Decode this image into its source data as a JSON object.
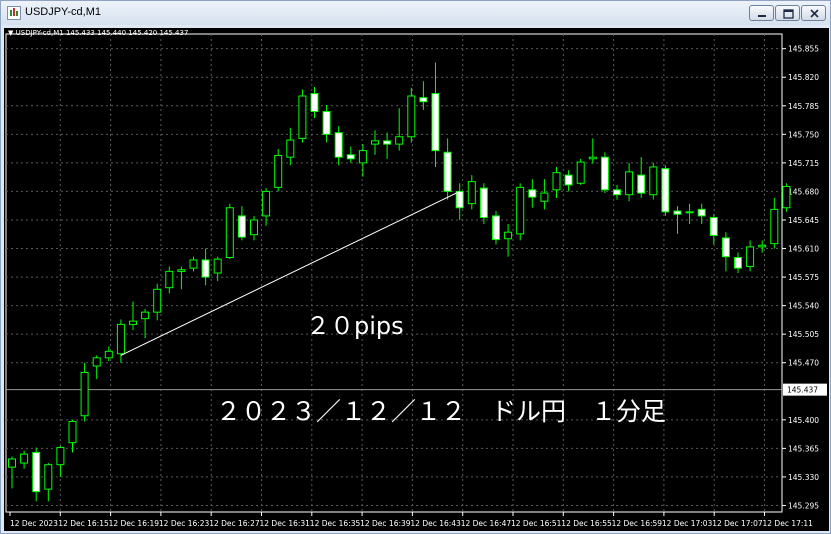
{
  "window": {
    "title": "USDJPY-cd,M1",
    "buttons": [
      {
        "name": "minimize-button",
        "icon": "minimize-icon"
      },
      {
        "name": "restore-button",
        "icon": "restore-icon"
      },
      {
        "name": "close-button",
        "icon": "close-icon"
      }
    ]
  },
  "chart": {
    "header_symbol": "USDJPY-cd,M1",
    "header_ohlc": "145.433 145.440 145.420 145.437",
    "annotation_pips": "２０pips",
    "annotation_title": "２０２３／１２／１２　ドル円　１分足",
    "current_price_label": "145.437",
    "colors": {
      "background": "#000000",
      "bull_body": "#000000",
      "bear_body": "#ffffff",
      "wick": "#00ff00",
      "grid": "#5a5a5a",
      "axis_text": "#ffffff",
      "trendline": "#ffffff"
    }
  },
  "chart_data": {
    "type": "candlestick",
    "symbol": "USDJPY-cd",
    "timeframe": "M1",
    "y_ticks": [
      "145.855",
      "145.820",
      "145.785",
      "145.750",
      "145.715",
      "145.680",
      "145.645",
      "145.610",
      "145.575",
      "145.540",
      "145.505",
      "145.470",
      "145.437",
      "145.400",
      "145.365",
      "145.330",
      "145.295"
    ],
    "x_ticks": [
      "12 Dec 2023",
      "12 Dec 16:15",
      "12 Dec 16:19",
      "12 Dec 16:23",
      "12 Dec 16:27",
      "12 Dec 16:31",
      "12 Dec 16:35",
      "12 Dec 16:39",
      "12 Dec 16:43",
      "12 Dec 16:47",
      "12 Dec 16:51",
      "12 Dec 16:55",
      "12 Dec 16:59",
      "12 Dec 17:03",
      "12 Dec 17:07",
      "12 Dec 17:11"
    ],
    "ylim": [
      145.287,
      145.873
    ],
    "grid": true,
    "current_price": 145.437,
    "candles": [
      {
        "o": 145.342,
        "h": 145.355,
        "l": 145.316,
        "c": 145.352
      },
      {
        "o": 145.347,
        "h": 145.362,
        "l": 145.34,
        "c": 145.358
      },
      {
        "o": 145.36,
        "h": 145.366,
        "l": 145.3,
        "c": 145.312
      },
      {
        "o": 145.315,
        "h": 145.347,
        "l": 145.3,
        "c": 145.345
      },
      {
        "o": 145.345,
        "h": 145.368,
        "l": 145.33,
        "c": 145.366
      },
      {
        "o": 145.372,
        "h": 145.4,
        "l": 145.36,
        "c": 145.398
      },
      {
        "o": 145.405,
        "h": 145.47,
        "l": 145.398,
        "c": 145.458
      },
      {
        "o": 145.466,
        "h": 145.479,
        "l": 145.45,
        "c": 145.476
      },
      {
        "o": 145.476,
        "h": 145.49,
        "l": 145.472,
        "c": 145.484
      },
      {
        "o": 145.481,
        "h": 145.523,
        "l": 145.47,
        "c": 145.517
      },
      {
        "o": 145.517,
        "h": 145.545,
        "l": 145.51,
        "c": 145.521
      },
      {
        "o": 145.524,
        "h": 145.536,
        "l": 145.5,
        "c": 145.532
      },
      {
        "o": 145.532,
        "h": 145.567,
        "l": 145.522,
        "c": 145.56
      },
      {
        "o": 145.562,
        "h": 145.588,
        "l": 145.555,
        "c": 145.582
      },
      {
        "o": 145.582,
        "h": 145.588,
        "l": 145.56,
        "c": 145.584
      },
      {
        "o": 145.586,
        "h": 145.6,
        "l": 145.582,
        "c": 145.596
      },
      {
        "o": 145.596,
        "h": 145.61,
        "l": 145.565,
        "c": 145.575
      },
      {
        "o": 145.58,
        "h": 145.6,
        "l": 145.57,
        "c": 145.597
      },
      {
        "o": 145.599,
        "h": 145.665,
        "l": 145.597,
        "c": 145.66
      },
      {
        "o": 145.65,
        "h": 145.662,
        "l": 145.62,
        "c": 145.624
      },
      {
        "o": 145.627,
        "h": 145.65,
        "l": 145.62,
        "c": 145.645
      },
      {
        "o": 145.65,
        "h": 145.684,
        "l": 145.638,
        "c": 145.68
      },
      {
        "o": 145.685,
        "h": 145.732,
        "l": 145.68,
        "c": 145.724
      },
      {
        "o": 145.722,
        "h": 145.758,
        "l": 145.712,
        "c": 145.743
      },
      {
        "o": 145.745,
        "h": 145.805,
        "l": 145.74,
        "c": 145.797
      },
      {
        "o": 145.8,
        "h": 145.808,
        "l": 145.77,
        "c": 145.778
      },
      {
        "o": 145.778,
        "h": 145.786,
        "l": 145.74,
        "c": 145.75
      },
      {
        "o": 145.752,
        "h": 145.76,
        "l": 145.712,
        "c": 145.722
      },
      {
        "o": 145.725,
        "h": 145.735,
        "l": 145.715,
        "c": 145.72
      },
      {
        "o": 145.715,
        "h": 145.738,
        "l": 145.698,
        "c": 145.73
      },
      {
        "o": 145.738,
        "h": 145.755,
        "l": 145.725,
        "c": 145.742
      },
      {
        "o": 145.742,
        "h": 145.752,
        "l": 145.72,
        "c": 145.738
      },
      {
        "o": 145.738,
        "h": 145.782,
        "l": 145.73,
        "c": 145.747
      },
      {
        "o": 145.747,
        "h": 145.807,
        "l": 145.74,
        "c": 145.797
      },
      {
        "o": 145.795,
        "h": 145.815,
        "l": 145.78,
        "c": 145.79
      },
      {
        "o": 145.8,
        "h": 145.838,
        "l": 145.71,
        "c": 145.73
      },
      {
        "o": 145.728,
        "h": 145.745,
        "l": 145.67,
        "c": 145.68
      },
      {
        "o": 145.68,
        "h": 145.69,
        "l": 145.645,
        "c": 145.66
      },
      {
        "o": 145.665,
        "h": 145.7,
        "l": 145.658,
        "c": 145.692
      },
      {
        "o": 145.684,
        "h": 145.69,
        "l": 145.64,
        "c": 145.648
      },
      {
        "o": 145.65,
        "h": 145.656,
        "l": 145.615,
        "c": 145.621
      },
      {
        "o": 145.622,
        "h": 145.64,
        "l": 145.6,
        "c": 145.63
      },
      {
        "o": 145.628,
        "h": 145.69,
        "l": 145.62,
        "c": 145.685
      },
      {
        "o": 145.682,
        "h": 145.695,
        "l": 145.66,
        "c": 145.673
      },
      {
        "o": 145.668,
        "h": 145.695,
        "l": 145.658,
        "c": 145.678
      },
      {
        "o": 145.682,
        "h": 145.71,
        "l": 145.672,
        "c": 145.703
      },
      {
        "o": 145.7,
        "h": 145.706,
        "l": 145.68,
        "c": 145.688
      },
      {
        "o": 145.69,
        "h": 145.72,
        "l": 145.688,
        "c": 145.716
      },
      {
        "o": 145.72,
        "h": 145.745,
        "l": 145.714,
        "c": 145.722
      },
      {
        "o": 145.722,
        "h": 145.728,
        "l": 145.678,
        "c": 145.682
      },
      {
        "o": 145.682,
        "h": 145.688,
        "l": 145.67,
        "c": 145.676
      },
      {
        "o": 145.676,
        "h": 145.715,
        "l": 145.668,
        "c": 145.704
      },
      {
        "o": 145.7,
        "h": 145.722,
        "l": 145.672,
        "c": 145.678
      },
      {
        "o": 145.676,
        "h": 145.715,
        "l": 145.67,
        "c": 145.71
      },
      {
        "o": 145.708,
        "h": 145.712,
        "l": 145.65,
        "c": 145.655
      },
      {
        "o": 145.656,
        "h": 145.662,
        "l": 145.628,
        "c": 145.652
      },
      {
        "o": 145.654,
        "h": 145.665,
        "l": 145.64,
        "c": 145.655
      },
      {
        "o": 145.658,
        "h": 145.665,
        "l": 145.64,
        "c": 145.65
      },
      {
        "o": 145.648,
        "h": 145.652,
        "l": 145.615,
        "c": 145.626
      },
      {
        "o": 145.623,
        "h": 145.63,
        "l": 145.582,
        "c": 145.6
      },
      {
        "o": 145.599,
        "h": 145.605,
        "l": 145.58,
        "c": 145.586
      },
      {
        "o": 145.588,
        "h": 145.62,
        "l": 145.582,
        "c": 145.612
      },
      {
        "o": 145.612,
        "h": 145.62,
        "l": 145.605,
        "c": 145.614
      },
      {
        "o": 145.616,
        "h": 145.672,
        "l": 145.61,
        "c": 145.658
      },
      {
        "o": 145.66,
        "h": 145.69,
        "l": 145.655,
        "c": 145.686
      }
    ],
    "trendline": {
      "from": {
        "candle": 9,
        "price": 145.479
      },
      "to": {
        "candle": 37,
        "price": 145.68
      }
    }
  }
}
